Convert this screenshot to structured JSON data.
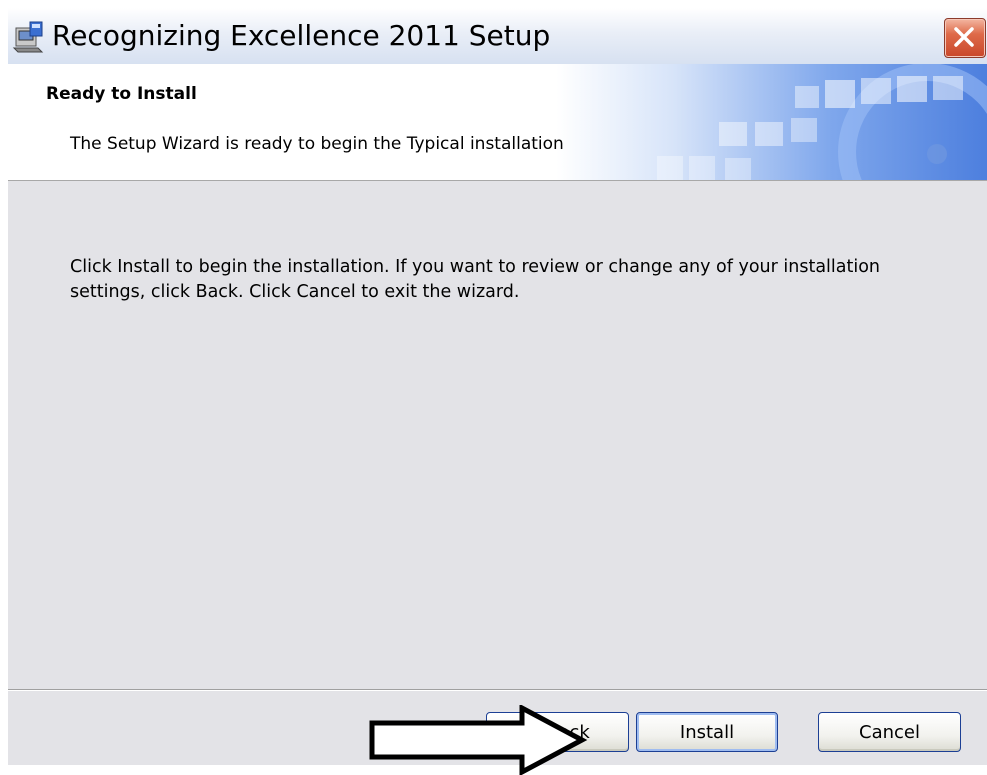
{
  "window": {
    "title": "Recognizing Excellence 2011 Setup",
    "icon": "installer-icon"
  },
  "banner": {
    "title": "Ready to Install",
    "description": "The Setup Wizard is ready to begin the Typical installation"
  },
  "main": {
    "body_text": "Click Install to begin the installation.  If you want to review or change any of your installation settings, click Back.  Click Cancel to exit the wizard."
  },
  "buttons": {
    "back_label": "< Back",
    "install_label": "Install",
    "cancel_label": "Cancel"
  },
  "annotation": {
    "arrow": "pointer-arrow pointing to Install button"
  },
  "colors": {
    "close_button": "#d9583a",
    "banner_blue": "#4d7fde",
    "panel_background": "#e3e3e7",
    "button_border": "#1c3f94"
  }
}
